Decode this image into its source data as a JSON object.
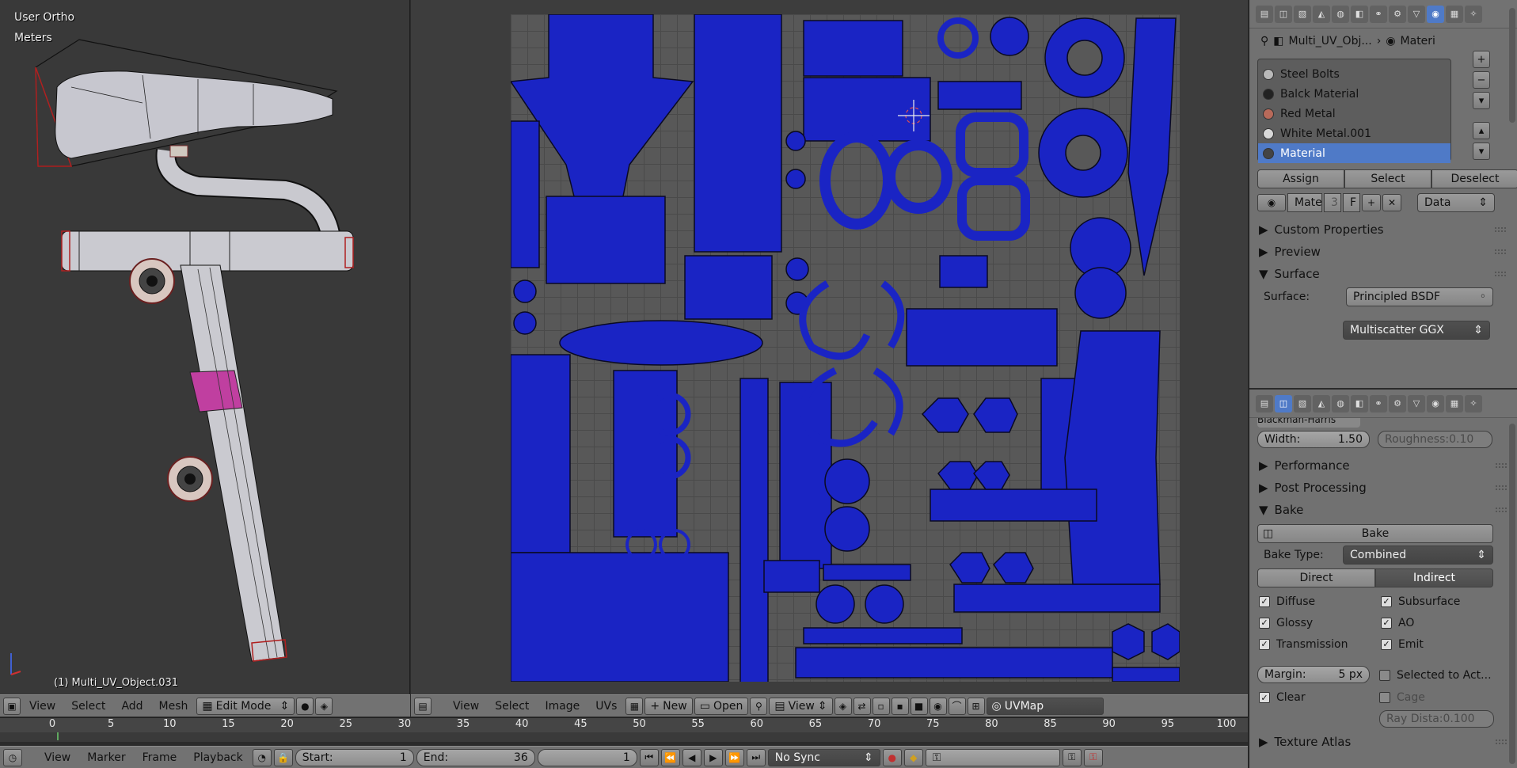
{
  "viewport3d": {
    "view_name": "User Ortho",
    "units": "Meters",
    "object_label": "(1) Multi_UV_Object.031",
    "header": {
      "view": "View",
      "select": "Select",
      "add": "Add",
      "mesh": "Mesh",
      "mode": "Edit Mode"
    }
  },
  "uv_editor": {
    "header": {
      "view": "View",
      "select": "Select",
      "image": "Image",
      "uvs": "UVs",
      "new": "New",
      "open": "Open",
      "view2": "View",
      "uvmap": "UVMap"
    }
  },
  "timeline": {
    "ticks": [
      "0",
      "5",
      "10",
      "15",
      "20",
      "25",
      "30",
      "35",
      "40",
      "45",
      "50",
      "55",
      "60",
      "65",
      "70",
      "75",
      "80",
      "85",
      "90",
      "95",
      "100"
    ],
    "menus": {
      "view": "View",
      "marker": "Marker",
      "frame": "Frame",
      "playback": "Playback"
    },
    "start_label": "Start:",
    "start_value": "1",
    "end_label": "End:",
    "end_value": "36",
    "current_frame": "1",
    "sync": "No Sync"
  },
  "properties": {
    "breadcrumb": {
      "object": "Multi_UV_Obj...",
      "material": "Materi"
    },
    "materials": [
      {
        "name": "Steel Bolts",
        "color": "#b9b9b9"
      },
      {
        "name": "Balck Material",
        "color": "#222222"
      },
      {
        "name": "Red Metal",
        "color": "#b86a5a"
      },
      {
        "name": "White Metal.001",
        "color": "#d8d8d8"
      },
      {
        "name": "Material",
        "color": "#444444",
        "selected": true
      }
    ],
    "assign": "Assign",
    "select": "Select",
    "deselect": "Deselect",
    "mat_name": "Mate",
    "mat_users": "3",
    "fake_user": "F",
    "link": "Data",
    "sections": {
      "custom_properties": "Custom Properties",
      "preview": "Preview",
      "surface": "Surface"
    },
    "surface_label": "Surface:",
    "surface_value": "Principled BSDF",
    "distribution": "Multiscatter GGX",
    "filter_partial": "Blackman-Harris",
    "width_label": "Width:",
    "width_value": "1.50",
    "roughness": "Roughness:0.10",
    "performance": "Performance",
    "post_processing": "Post Processing",
    "bake_section": "Bake",
    "bake_button": "Bake",
    "bake_type_label": "Bake Type:",
    "bake_type_value": "Combined",
    "direct": "Direct",
    "indirect": "Indirect",
    "checks": {
      "diffuse": "Diffuse",
      "subsurface": "Subsurface",
      "glossy": "Glossy",
      "ao": "AO",
      "transmission": "Transmission",
      "emit": "Emit"
    },
    "margin_label": "Margin:",
    "margin_value": "5 px",
    "selected_to_active": "Selected to Act...",
    "clear": "Clear",
    "cage": "Cage",
    "ray_distance": "Ray Dista:0.100",
    "texture_atlas": "Texture Atlas"
  },
  "colors": {
    "accent": "#4f7ac7",
    "uv_island": "#1a24c4",
    "header": "#727272"
  }
}
